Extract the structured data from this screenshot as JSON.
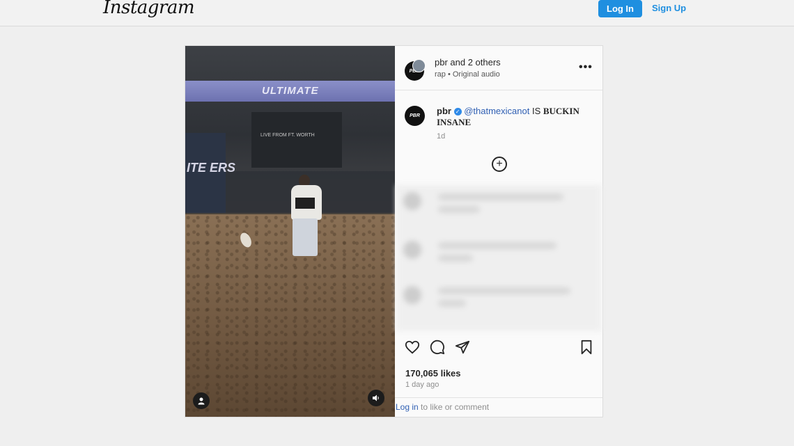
{
  "app": {
    "logo": "Instagram"
  },
  "topbar": {
    "login_label": "Log In",
    "signup_label": "Sign Up"
  },
  "video": {
    "banner_text": "ULTIMATE",
    "tunnel_text": "LIVE FROM  FT. WORTH",
    "side_text": "ITE ERS",
    "account_icon": "person-icon",
    "sound_icon": "speaker-icon"
  },
  "post": {
    "header": {
      "name": "pbr and 2 others",
      "sub": "rap • Original audio",
      "avatar_text": "PBR"
    },
    "caption": {
      "author": "pbr",
      "mention": "@thatmexicanot",
      "text_plain": " IS ",
      "text_bold": "BUCKIN INSANE",
      "time": "1d"
    },
    "likes": "170,065 likes",
    "time_ago": "1 day ago",
    "footer": {
      "link": "Log in",
      "rest": " to like or comment"
    }
  },
  "colors": {
    "accent": "#1f8fe0",
    "link": "#2f5fb3",
    "verified": "#2f8ae8"
  }
}
